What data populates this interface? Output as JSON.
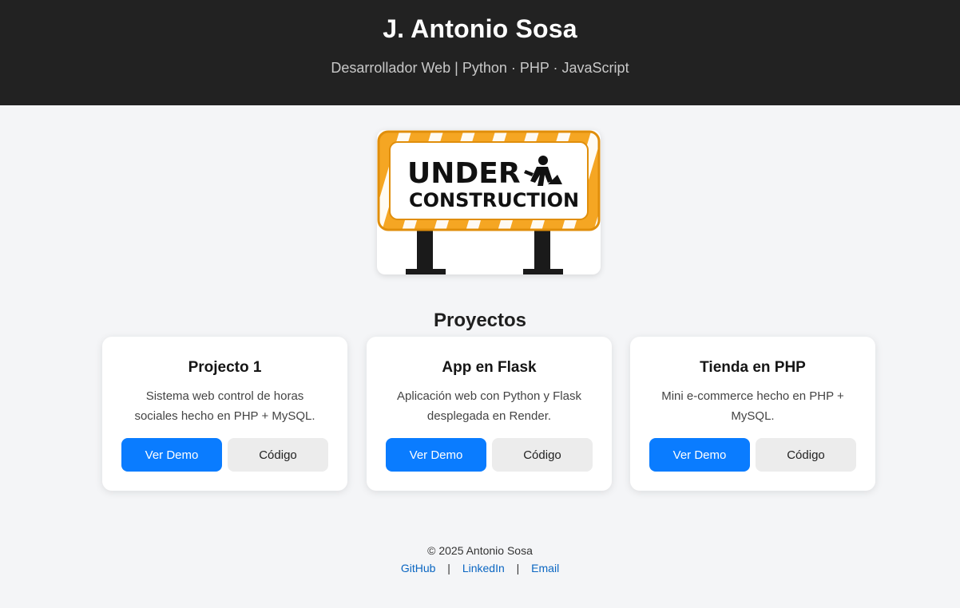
{
  "header": {
    "title": "J. Antonio Sosa",
    "subtitle": "Desarrollador Web | Python · PHP · JavaScript"
  },
  "hero": {
    "line1": "UNDER",
    "line2": "CONSTRUCTION",
    "icon": "worker-shovel-icon",
    "colors": {
      "frame": "#f5a623",
      "stripe": "#ffffff",
      "post": "#1a1a1a"
    }
  },
  "projects": {
    "title": "Proyectos",
    "items": [
      {
        "title": "Projecto 1",
        "description": "Sistema web control de horas sociales hecho en PHP + MySQL.",
        "demo_label": "Ver Demo",
        "code_label": "Código"
      },
      {
        "title": "App en Flask",
        "description": "Aplicación web con Python y Flask desplegada en Render.",
        "demo_label": "Ver Demo",
        "code_label": "Código"
      },
      {
        "title": "Tienda en PHP",
        "description": "Mini e-commerce hecho en PHP + MySQL.",
        "demo_label": "Ver Demo",
        "code_label": "Código"
      }
    ]
  },
  "footer": {
    "copyright": "© 2025 Antonio Sosa",
    "links": [
      "GitHub",
      "LinkedIn",
      "Email"
    ],
    "separator": "|"
  },
  "colors": {
    "header_bg": "#222222",
    "accent": "#0a7cff",
    "link": "#0a66c2",
    "page_bg": "#f4f5f7"
  }
}
